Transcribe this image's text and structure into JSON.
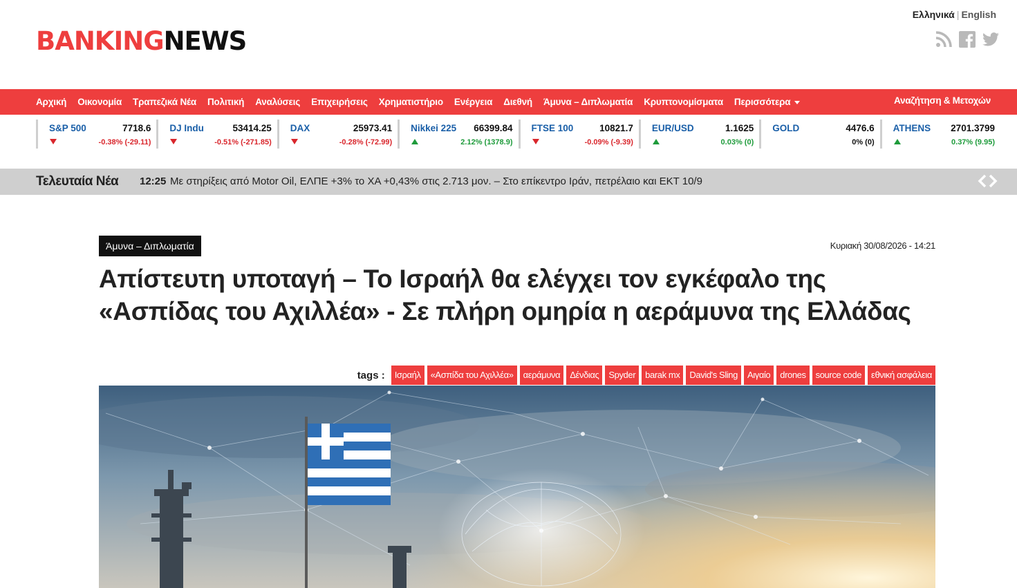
{
  "header": {
    "logo_part1": "BANKING",
    "logo_part2": "NEWS",
    "lang_greek": "Ελληνικά",
    "lang_sep": "|",
    "lang_english": "English",
    "social_icons": [
      "rss-icon",
      "facebook-icon",
      "twitter-icon"
    ]
  },
  "nav": {
    "items": [
      "Αρχική",
      "Οικονομία",
      "Τραπεζικά Νέα",
      "Πολιτική",
      "Αναλύσεις",
      "Επιχειρήσεις",
      "Χρηματιστήριο",
      "Ενέργεια",
      "Διεθνή",
      "Άμυνα – Διπλωματία",
      "Κρυπτονομίσματα",
      "Περισσότερα"
    ],
    "search": "Αναζήτηση & Μετοχών"
  },
  "ticker": [
    {
      "name": "S&P 500",
      "value": "7718.6",
      "change": "-0.38% (-29.11)",
      "dir": "down"
    },
    {
      "name": "DJ Indu",
      "value": "53414.25",
      "change": "-0.51% (-271.85)",
      "dir": "down"
    },
    {
      "name": "DAX",
      "value": "25973.41",
      "change": "-0.28% (-72.99)",
      "dir": "down"
    },
    {
      "name": "Nikkei 225",
      "value": "66399.84",
      "change": "2.12% (1378.9)",
      "dir": "up"
    },
    {
      "name": "FTSE 100",
      "value": "10821.7",
      "change": "-0.09% (-9.39)",
      "dir": "down"
    },
    {
      "name": "EUR/USD",
      "value": "1.1625",
      "change": "0.03% (0)",
      "dir": "up"
    },
    {
      "name": "GOLD",
      "value": "4476.6",
      "change": "0% (0)",
      "dir": "flat"
    },
    {
      "name": "ATHENS",
      "value": "2701.3799",
      "change": "0.37% (9.95)",
      "dir": "up"
    }
  ],
  "latest": {
    "label": "Τελευταία Νέα",
    "time": "12:25",
    "text": "Με στηρίξεις από Motor Oil, ΕΛΠΕ +3% το ΧΑ +0,43% στις 2.713 μον. – Στο επίκεντρο Ιράν, πετρέλαιο και ΕΚΤ 10/9"
  },
  "article": {
    "category": "Άμυνα – Διπλωματία",
    "date": "Κυριακή 30/08/2026 - 14:21",
    "title": "Απίστευτη υποταγή – Το Ισραήλ θα ελέγχει τον εγκέφαλο της «Ασπίδας του Αχιλλέα» - Σε πλήρη ομηρία η αεράμυνα της Ελλάδας",
    "tags_label": "tags :",
    "tags": [
      "Ισραήλ",
      "«Ασπίδα του Αχιλλέα»",
      "αεράμυνα",
      "Δένδιας",
      "Spyder",
      "barak mx",
      "David's Sling",
      "Αιγαίο",
      "drones",
      "source code",
      "εθνική ασφάλεια"
    ]
  },
  "colors": {
    "brand_red": "#ee3e3e",
    "up": "#1e9b3b",
    "down": "#d9262c",
    "link_blue": "#1a5fa8"
  }
}
